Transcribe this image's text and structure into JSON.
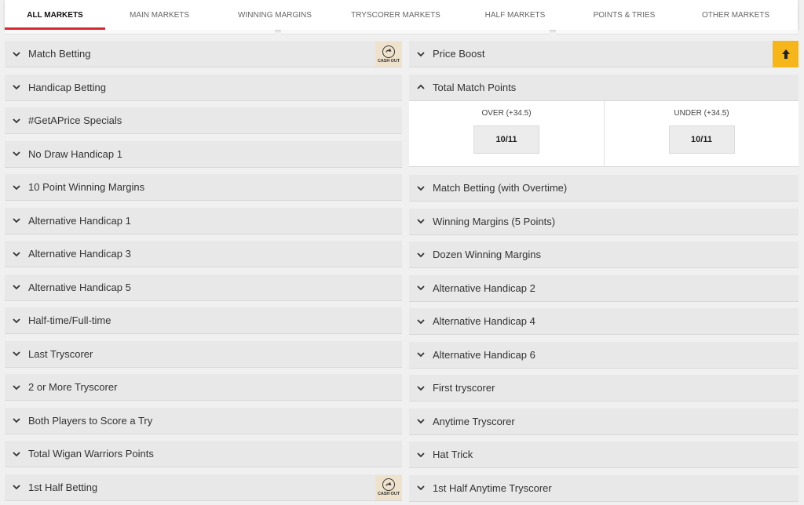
{
  "tabs": [
    {
      "label": "ALL MARKETS"
    },
    {
      "label": "MAIN MARKETS"
    },
    {
      "label": "WINNING MARGINS"
    },
    {
      "label": "TRYSCORER MARKETS"
    },
    {
      "label": "HALF MARKETS"
    },
    {
      "label": "POINTS & TRIES"
    },
    {
      "label": "OTHER MARKETS"
    }
  ],
  "cashout_label": "CASH OUT",
  "colors": {
    "accent": "#d7282f",
    "boost": "#f5b51b",
    "cashout_bg": "#efe2cc"
  },
  "left_markets": [
    {
      "label": "Match Betting"
    },
    {
      "label": "Handicap Betting"
    },
    {
      "label": "#GetAPrice Specials"
    },
    {
      "label": "No Draw Handicap 1"
    },
    {
      "label": "10 Point Winning Margins"
    },
    {
      "label": "Alternative Handicap 1"
    },
    {
      "label": "Alternative Handicap 3"
    },
    {
      "label": "Alternative Handicap 5"
    },
    {
      "label": "Half-time/Full-time"
    },
    {
      "label": "Last Tryscorer"
    },
    {
      "label": "2 or More Tryscorer"
    },
    {
      "label": "Both Players to Score a Try"
    },
    {
      "label": "Total Wigan Warriors Points"
    },
    {
      "label": "1st Half Betting"
    }
  ],
  "right_markets": {
    "price_boost": {
      "label": "Price Boost"
    },
    "total_points": {
      "label": "Total Match Points",
      "selections": [
        {
          "name": "OVER (+34.5)",
          "price": "10/11"
        },
        {
          "name": "UNDER (+34.5)",
          "price": "10/11"
        }
      ]
    },
    "rest": [
      {
        "label": "Match Betting (with Overtime)"
      },
      {
        "label": "Winning Margins (5 Points)"
      },
      {
        "label": "Dozen Winning Margins"
      },
      {
        "label": "Alternative Handicap 2"
      },
      {
        "label": "Alternative Handicap 4"
      },
      {
        "label": "Alternative Handicap 6"
      },
      {
        "label": "First tryscorer"
      },
      {
        "label": "Anytime Tryscorer"
      },
      {
        "label": "Hat Trick"
      },
      {
        "label": "1st Half Anytime Tryscorer"
      }
    ]
  }
}
